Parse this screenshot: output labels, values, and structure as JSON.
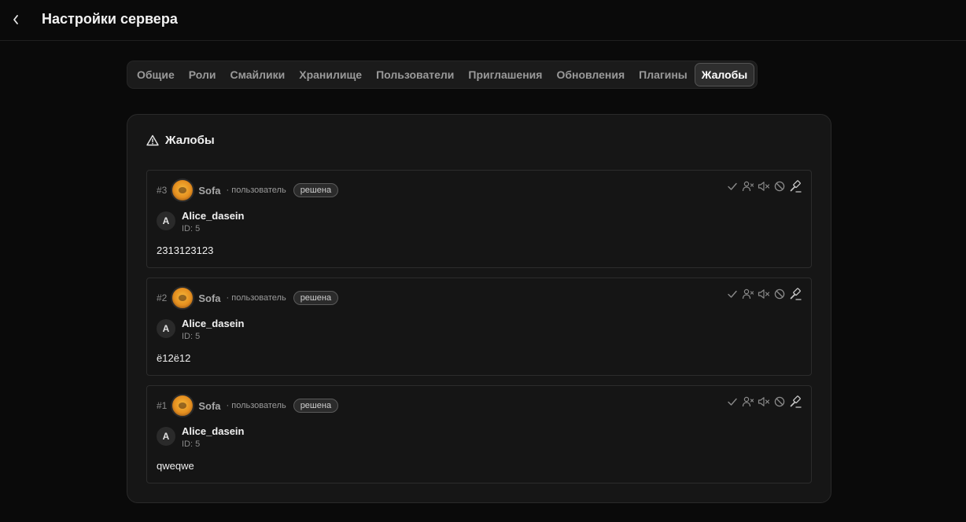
{
  "header": {
    "title": "Настройки сервера",
    "back_icon": "chevron-left-icon"
  },
  "tabs": [
    {
      "label": "Общие",
      "active": false
    },
    {
      "label": "Роли",
      "active": false
    },
    {
      "label": "Смайлики",
      "active": false
    },
    {
      "label": "Хранилище",
      "active": false
    },
    {
      "label": "Пользователи",
      "active": false
    },
    {
      "label": "Приглашения",
      "active": false
    },
    {
      "label": "Обновления",
      "active": false
    },
    {
      "label": "Плагины",
      "active": false
    },
    {
      "label": "Жалобы",
      "active": true
    }
  ],
  "panel": {
    "title": "Жалобы",
    "icon": "warning-icon"
  },
  "reports": [
    {
      "number": "#3",
      "reporter": "Sofa",
      "reporter_role": "· пользователь",
      "status": "решена",
      "target_initial": "A",
      "target_name": "Alice_dasein",
      "target_id": "ID: 5",
      "text": "2313123123"
    },
    {
      "number": "#2",
      "reporter": "Sofa",
      "reporter_role": "· пользователь",
      "status": "решена",
      "target_initial": "A",
      "target_name": "Alice_dasein",
      "target_id": "ID: 5",
      "text": "ё12ё12"
    },
    {
      "number": "#1",
      "reporter": "Sofa",
      "reporter_role": "· пользователь",
      "status": "решена",
      "target_initial": "A",
      "target_name": "Alice_dasein",
      "target_id": "ID: 5",
      "text": "qweqwe"
    }
  ],
  "report_actions": [
    "check-icon",
    "user-remove-icon",
    "mute-icon",
    "ban-icon",
    "gavel-icon"
  ]
}
